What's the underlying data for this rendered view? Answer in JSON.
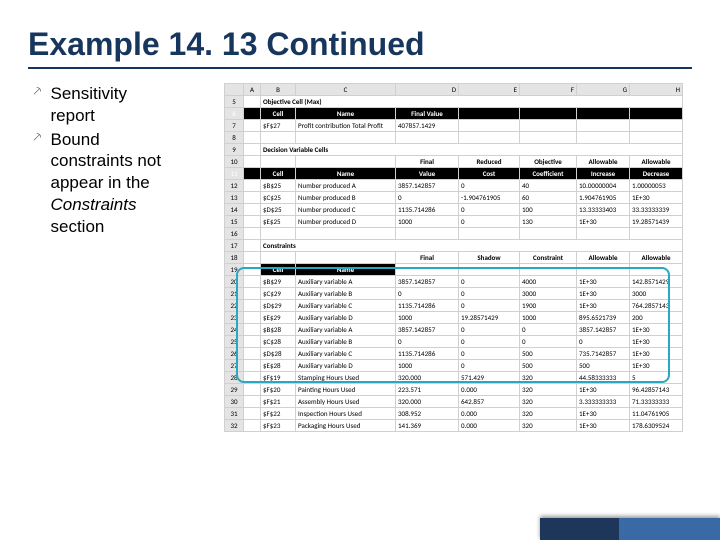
{
  "title": "Example 14. 13 Continued",
  "bullets": {
    "b1_l1": "Sensitivity",
    "b1_l2": "report",
    "b2_l1": "Bound",
    "b2_l2": "constraints not",
    "b2_l3": "appear in the",
    "b2_l4_i": "Constraints",
    "b2_l5": "section"
  },
  "cols": {
    "A": "A",
    "B": "B",
    "C": "C",
    "D": "D",
    "E": "E",
    "F": "F",
    "G": "G",
    "H": "H"
  },
  "rows": {
    "r5": "5",
    "r6": "6",
    "r7": "7",
    "r8": "8",
    "r9": "9",
    "r10": "10",
    "r11": "11",
    "r12": "12",
    "r13": "13",
    "r14": "14",
    "r15": "15",
    "r16": "16",
    "r17": "17",
    "r18": "18",
    "r19": "19",
    "r20": "20",
    "r21": "21",
    "r22": "22",
    "r23": "23",
    "r24": "24",
    "r25": "25",
    "r26": "26",
    "r27": "27",
    "r28": "28",
    "r29": "29",
    "r30": "30",
    "r31": "31",
    "r32": "32"
  },
  "s5": "Objective Cell (Max)",
  "h6": {
    "cell": "Cell",
    "name": "Name",
    "fv": "Final Value"
  },
  "r7": {
    "cell": "$F$27",
    "name": "Profit contribution Total Profit",
    "fv": "407857.1429"
  },
  "s9": "Decision Variable Cells",
  "h10": {
    "d1": "Final",
    "e1": "Reduced",
    "f1": "Objective",
    "g1": "Allowable",
    "h1": "Allowable"
  },
  "h11": {
    "cell": "Cell",
    "name": "Name",
    "d": "Value",
    "e": "Cost",
    "f": "Coefficient",
    "g": "Increase",
    "h": "Decrease"
  },
  "dv": [
    {
      "cell": "$B$25",
      "name": "Number produced A",
      "d": "3857.142857",
      "e": "0",
      "f": "40",
      "g": "10.00000004",
      "h": "1.00000053"
    },
    {
      "cell": "$C$25",
      "name": "Number produced B",
      "d": "0",
      "e": "-1.904761905",
      "f": "60",
      "g": "1.904761905",
      "h": "1E+30"
    },
    {
      "cell": "$D$25",
      "name": "Number produced C",
      "d": "1135.714286",
      "e": "0",
      "f": "100",
      "g": "13.33333403",
      "h": "33.33333339"
    },
    {
      "cell": "$E$25",
      "name": "Number produced D",
      "d": "1000",
      "e": "0",
      "f": "130",
      "g": "1E+30",
      "h": "19.28571439"
    }
  ],
  "s17": "Constraints",
  "h18": {
    "d1": "Final",
    "e1": "Shadow",
    "f1": "Constraint",
    "g1": "Allowable",
    "h1": "Allowable"
  },
  "cons": [
    {
      "cell": "$B$29",
      "name": "Auxiliary variable A",
      "d": "3857.142857",
      "e": "0",
      "f": "4000",
      "g": "1E+30",
      "h": "142.8571429"
    },
    {
      "cell": "$C$29",
      "name": "Auxiliary variable B",
      "d": "0",
      "e": "0",
      "f": "3000",
      "g": "1E+30",
      "h": "3000"
    },
    {
      "cell": "$D$29",
      "name": "Auxiliary variable C",
      "d": "1135.714286",
      "e": "0",
      "f": "1900",
      "g": "1E+30",
      "h": "764.2857143"
    },
    {
      "cell": "$E$29",
      "name": "Auxiliary variable D",
      "d": "1000",
      "e": "19.28571429",
      "f": "1000",
      "g": "895.6521739",
      "h": "200"
    },
    {
      "cell": "$B$28",
      "name": "Auxiliary variable A",
      "d": "3857.142857",
      "e": "0",
      "f": "0",
      "g": "3857.142857",
      "h": "1E+30"
    },
    {
      "cell": "$C$28",
      "name": "Auxiliary variable B",
      "d": "0",
      "e": "0",
      "f": "0",
      "g": "0",
      "h": "1E+30"
    },
    {
      "cell": "$D$28",
      "name": "Auxiliary variable C",
      "d": "1135.714286",
      "e": "0",
      "f": "500",
      "g": "735.7142857",
      "h": "1E+30"
    },
    {
      "cell": "$E$28",
      "name": "Auxiliary variable D",
      "d": "1000",
      "e": "0",
      "f": "500",
      "g": "500",
      "h": "1E+30"
    },
    {
      "cell": "$F$19",
      "name": "Stamping Hours Used",
      "d": "320.000",
      "e": "571.429",
      "f": "320",
      "g": "44.58333333",
      "h": "5"
    },
    {
      "cell": "$F$20",
      "name": "Painting Hours Used",
      "d": "223.571",
      "e": "0.000",
      "f": "320",
      "g": "1E+30",
      "h": "96.42857143"
    },
    {
      "cell": "$F$21",
      "name": "Assembly Hours Used",
      "d": "320.000",
      "e": "642.857",
      "f": "320",
      "g": "3.333333333",
      "h": "71.33333333"
    },
    {
      "cell": "$F$22",
      "name": "Inspection Hours Used",
      "d": "308.952",
      "e": "0.000",
      "f": "320",
      "g": "1E+30",
      "h": "11.04761905"
    },
    {
      "cell": "$F$23",
      "name": "Packaging Hours Used",
      "d": "141.369",
      "e": "0.000",
      "f": "320",
      "g": "1E+30",
      "h": "178.6309524"
    }
  ]
}
